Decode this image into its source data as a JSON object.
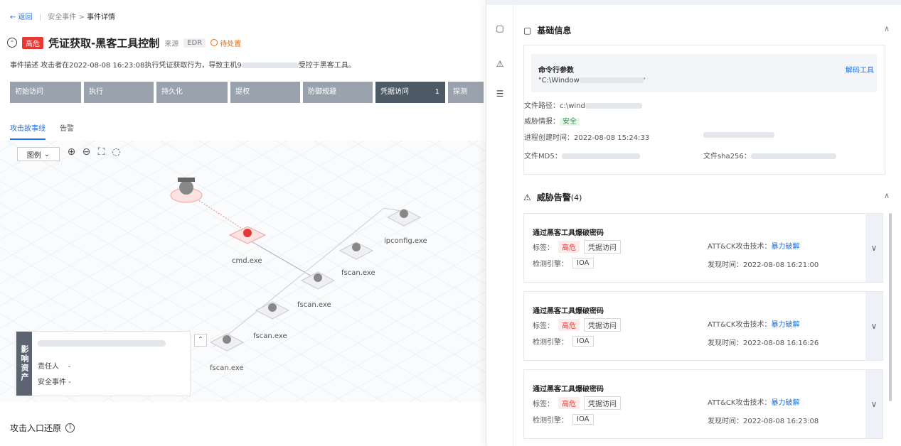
{
  "breadcrumb": {
    "back": "← 返回",
    "sep": "|",
    "path": "安全事件 > ",
    "current": "事件详情"
  },
  "event": {
    "severity": "高危",
    "title": "凭证获取-黑客工具控制",
    "source_label": "来源",
    "source_value": "EDR",
    "status": "待处置",
    "desc_prefix": "事件描述 攻击者在2022-08-08 16:23:08执行凭证获取行为，导致主机9",
    "desc_suffix": "受控于黑客工具。"
  },
  "stages": [
    {
      "label": "初始访问"
    },
    {
      "label": "执行"
    },
    {
      "label": "持久化"
    },
    {
      "label": "提权"
    },
    {
      "label": "防御规避"
    },
    {
      "label": "凭据访问",
      "count": "1"
    },
    {
      "label": "探测"
    }
  ],
  "tabs": [
    "攻击故事线",
    "告警"
  ],
  "graph": {
    "legend_label": "图例",
    "nodes": [
      "cmd.exe",
      "ipconfig.exe",
      "fscan.exe",
      "fscan.exe",
      "fscan.exe",
      "fscan.exe"
    ]
  },
  "asset": {
    "side_label": "影响资产",
    "owner_label": "责任人",
    "owner_value": "-",
    "event_label": "安全事件",
    "event_value": "-"
  },
  "entry_title": "攻击入口还原",
  "panel": {
    "basic": {
      "title": "基础信息",
      "cmd_label": "命令行参数",
      "cmd_value": "\"C:\\Window",
      "cmd_tail": "'",
      "decode_link": "解码工具",
      "file_path_label": "文件路径：",
      "file_path_value": "c:\\wind",
      "threat_label": "威胁情报：",
      "threat_value": "安全",
      "create_time_label": "进程创建时间：",
      "create_time_value": "2022-08-08 15:24:33",
      "md5_label": "文件MD5：",
      "sha256_label": "文件sha256："
    },
    "alerts": {
      "title": "威胁告警",
      "count": "(4)",
      "items": [
        {
          "name": "通过黑客工具爆破密码",
          "tag_label": "标签：",
          "tag_sev": "高危",
          "tag_cat": "凭据访问",
          "engine_label": "检测引擎：",
          "engine": "IOA",
          "tech_label": "ATT&CK攻击技术：",
          "tech": "暴力破解",
          "time_label": "发现时间：",
          "time": "2022-08-08 16:21:00"
        },
        {
          "name": "通过黑客工具爆破密码",
          "tag_label": "标签：",
          "tag_sev": "高危",
          "tag_cat": "凭据访问",
          "engine_label": "检测引擎：",
          "engine": "IOA",
          "tech_label": "ATT&CK攻击技术：",
          "tech": "暴力破解",
          "time_label": "发现时间：",
          "time": "2022-08-08 16:16:26"
        },
        {
          "name": "通过黑客工具爆破密码",
          "tag_label": "标签：",
          "tag_sev": "高危",
          "tag_cat": "凭据访问",
          "engine_label": "检测引擎：",
          "engine": "IOA",
          "tech_label": "ATT&CK攻击技术：",
          "tech": "暴力破解",
          "time_label": "发现时间：",
          "time": "2022-08-08 16:23:08"
        }
      ]
    }
  },
  "colors": {
    "accent": "#1f6fe5",
    "danger": "#e53935",
    "pending": "#f56a00",
    "stage": "#9aa3ad",
    "stage_active": "#4e5966"
  }
}
